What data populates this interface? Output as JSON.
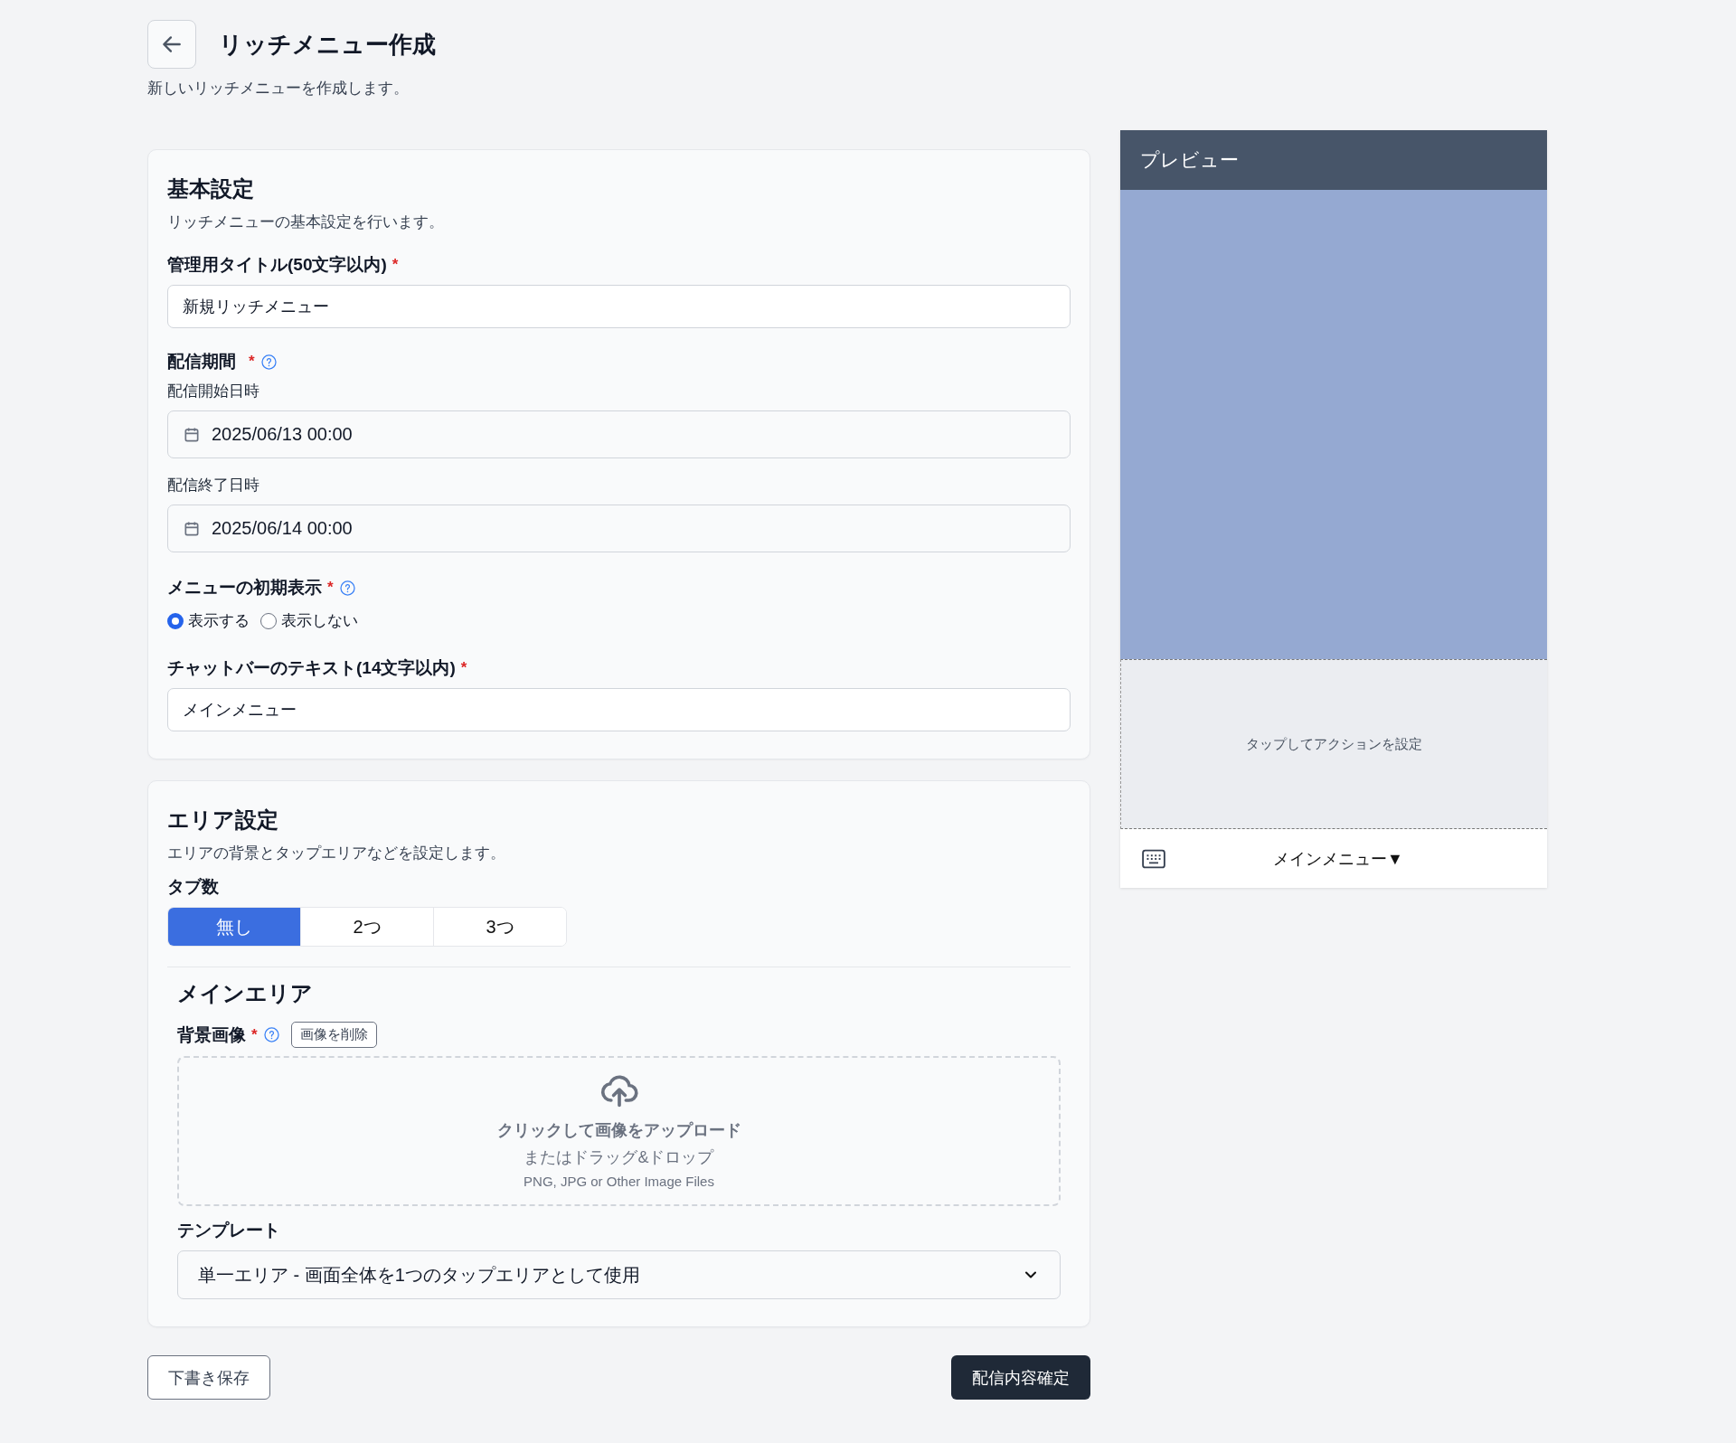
{
  "header": {
    "title": "リッチメニュー作成",
    "subtitle": "新しいリッチメニューを作成します。"
  },
  "basic_settings": {
    "title": "基本設定",
    "description": "リッチメニューの基本設定を行います。",
    "title_field": {
      "label": "管理用タイトル(50文字以内)",
      "required_mark": "*",
      "value": "新規リッチメニュー"
    },
    "period": {
      "label": "配信期間",
      "required_mark": "*",
      "help": true,
      "start": {
        "label": "配信開始日時",
        "value": "2025/06/13 00:00"
      },
      "end": {
        "label": "配信終了日時",
        "value": "2025/06/14 00:00"
      }
    },
    "initial_display": {
      "label": "メニューの初期表示",
      "required_mark": "*",
      "help": true,
      "options": [
        {
          "label": "表示する",
          "selected": true
        },
        {
          "label": "表示しない",
          "selected": false
        }
      ]
    },
    "chat_bar_text": {
      "label": "チャットバーのテキスト(14文字以内)",
      "required_mark": "*",
      "value": "メインメニュー"
    }
  },
  "area_settings": {
    "title": "エリア設定",
    "description": "エリアの背景とタップエリアなどを設定します。",
    "tab_count": {
      "label": "タブ数",
      "options": [
        {
          "label": "無し",
          "selected": true
        },
        {
          "label": "2つ",
          "selected": false
        },
        {
          "label": "3つ",
          "selected": false
        }
      ]
    },
    "main_area": {
      "title": "メインエリア",
      "background_image": {
        "label": "背景画像",
        "required_mark": "*",
        "help": true,
        "delete_button": "画像を削除"
      },
      "upload": {
        "title": "クリックして画像をアップロード",
        "subtitle": "またはドラッグ&ドロップ",
        "hint": "PNG, JPG or Other Image Files"
      },
      "template": {
        "label": "テンプレート",
        "value": "単一エリア - 画面全体を1つのタップエリアとして使用"
      }
    }
  },
  "actions": {
    "draft": "下書き保存",
    "confirm": "配信内容確定"
  },
  "preview": {
    "title": "プレビュー",
    "tap_hint": "タップしてアクションを設定",
    "chat_bar_text": "メインメニュー▼"
  }
}
